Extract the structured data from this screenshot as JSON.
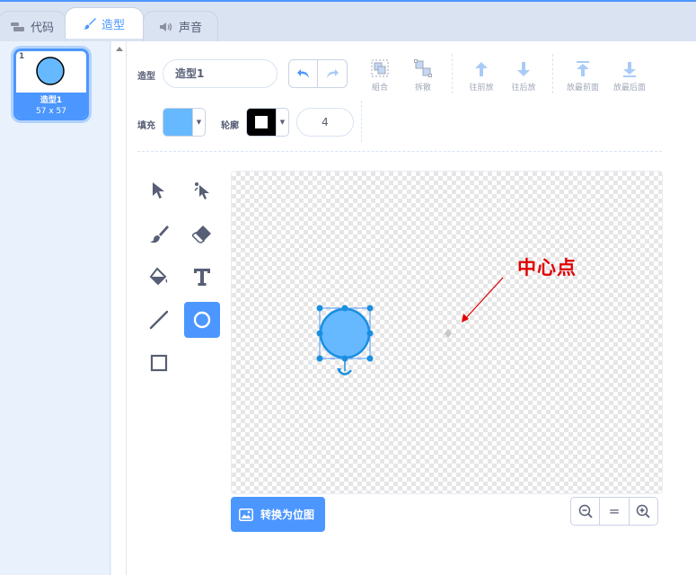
{
  "tabs": [
    {
      "label": "代码",
      "icon": "code-blocks-icon"
    },
    {
      "label": "造型",
      "icon": "brush-icon"
    },
    {
      "label": "声音",
      "icon": "speaker-icon"
    }
  ],
  "costume": {
    "number": "1",
    "name": "造型1",
    "size": "57 x 57"
  },
  "toolbar": {
    "costume_label": "造型",
    "costume_name": "造型1",
    "group_label": "組合",
    "ungroup_label": "拆散",
    "forward_label": "往前放",
    "backward_label": "往后放",
    "front_label": "放最前面",
    "back_label": "放最后面",
    "fill_label": "填充",
    "outline_label": "轮廓",
    "stroke_width": "4"
  },
  "colors": {
    "fill": "#66b8ff",
    "outline": "#000000",
    "accent": "#4c97ff",
    "annotation": "#e00000"
  },
  "canvas": {
    "annotation": "中心点"
  },
  "footer": {
    "convert_label": "转换为位图"
  },
  "zoom": {
    "out": "zoom-out-icon",
    "reset": "=",
    "in": "zoom-in-icon"
  }
}
